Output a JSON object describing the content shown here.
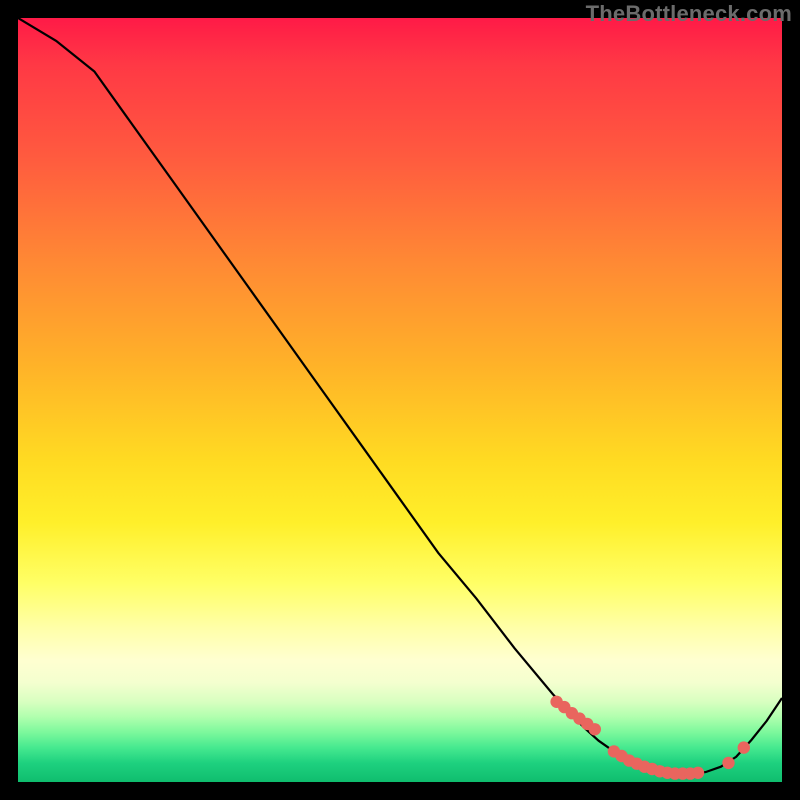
{
  "watermark": "TheBottleneck.com",
  "colors": {
    "curve": "#000000",
    "marker": "#e9655e"
  },
  "chart_data": {
    "type": "line",
    "title": "",
    "xlabel": "",
    "ylabel": "",
    "xlim": [
      0,
      1
    ],
    "ylim": [
      0,
      1
    ],
    "x": [
      0.0,
      0.05,
      0.1,
      0.15,
      0.2,
      0.25,
      0.3,
      0.35,
      0.4,
      0.45,
      0.5,
      0.55,
      0.6,
      0.65,
      0.7,
      0.72,
      0.74,
      0.76,
      0.78,
      0.8,
      0.82,
      0.84,
      0.86,
      0.88,
      0.9,
      0.92,
      0.94,
      0.96,
      0.98,
      1.0
    ],
    "values": [
      1.0,
      0.97,
      0.93,
      0.86,
      0.79,
      0.72,
      0.65,
      0.58,
      0.51,
      0.44,
      0.37,
      0.3,
      0.24,
      0.175,
      0.115,
      0.093,
      0.072,
      0.054,
      0.04,
      0.028,
      0.02,
      0.014,
      0.011,
      0.011,
      0.013,
      0.02,
      0.033,
      0.055,
      0.08,
      0.11
    ],
    "markers_x": [
      0.705,
      0.715,
      0.725,
      0.735,
      0.745,
      0.755,
      0.78,
      0.79,
      0.8,
      0.81,
      0.82,
      0.83,
      0.84,
      0.85,
      0.86,
      0.87,
      0.88,
      0.89,
      0.93,
      0.95
    ],
    "markers_y": [
      0.105,
      0.098,
      0.09,
      0.083,
      0.076,
      0.069,
      0.04,
      0.034,
      0.028,
      0.024,
      0.02,
      0.017,
      0.014,
      0.012,
      0.011,
      0.011,
      0.011,
      0.012,
      0.025,
      0.045
    ]
  }
}
